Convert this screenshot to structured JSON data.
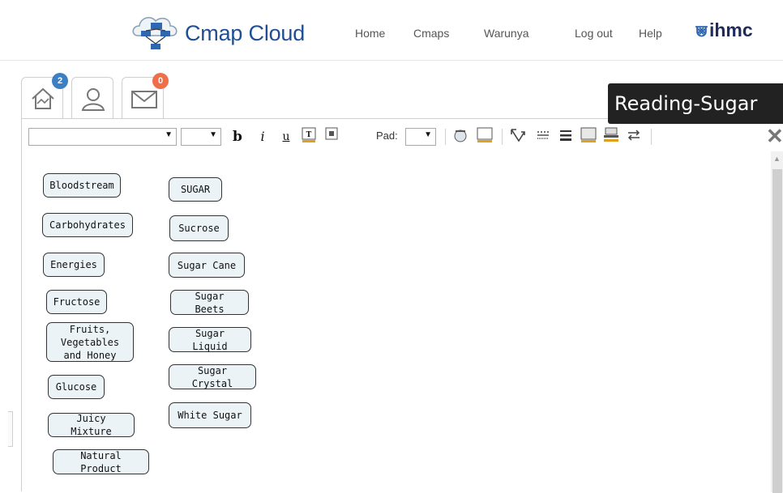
{
  "header": {
    "brand": "Cmap Cloud",
    "nav": [
      "Home",
      "Cmaps",
      "Warunya",
      "Log out",
      "Help"
    ],
    "partner_logo": "ihmc"
  },
  "tabs": [
    {
      "icon": "home-icon",
      "badge": "2",
      "badge_color": "#3c7fc5"
    },
    {
      "icon": "user-icon",
      "badge": "",
      "badge_color": ""
    },
    {
      "icon": "mail-icon",
      "badge": "0",
      "badge_color": "#ef6f4a"
    }
  ],
  "map_title": "Reading-Sugar",
  "toolbar": {
    "font_value": "",
    "size_value": "",
    "bold": "b",
    "italic": "i",
    "underline": "u",
    "pad_label": "Pad:",
    "pad_value": ""
  },
  "concepts": [
    {
      "label": "Bloodstream"
    },
    {
      "label": "Carbohydrates"
    },
    {
      "label": "Energies"
    },
    {
      "label": "Fructose"
    },
    {
      "label": "Fruits, Vegetables and Honey"
    },
    {
      "label": "Glucose"
    },
    {
      "label": "Juicy Mixture"
    },
    {
      "label": "Natural Product"
    },
    {
      "label": "SUGAR"
    },
    {
      "label": "Sucrose"
    },
    {
      "label": "Sugar Cane"
    },
    {
      "label": "Sugar Beets"
    },
    {
      "label": "Sugar Liquid"
    },
    {
      "label": "Sugar Crystal"
    },
    {
      "label": "White Sugar"
    }
  ],
  "colors": {
    "brand": "#1f4e96",
    "concept_fill": "#ecf3f7",
    "title_bg": "#222222"
  }
}
